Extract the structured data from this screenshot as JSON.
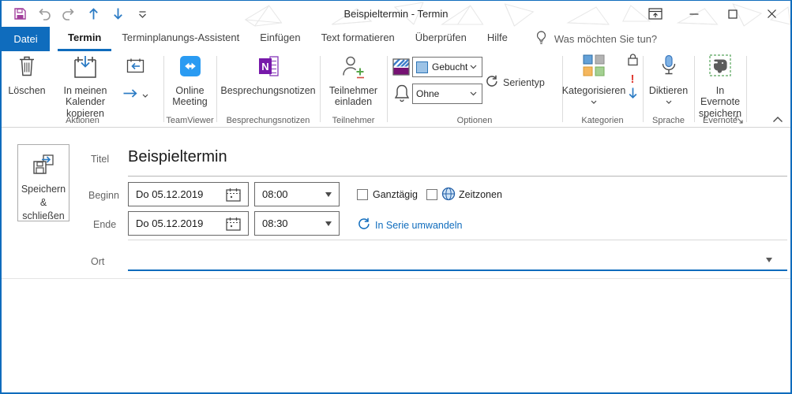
{
  "colors": {
    "accent": "#0F6CBD",
    "teamviewer_blue": "#2A9BF2",
    "onenote_purple": "#7719AA",
    "status_purple": "#761173",
    "save_icon_purple": "#A23F9C",
    "high_importance_red": "#E03B32",
    "evernote_green": "#58A55C"
  },
  "window": {
    "title": "Beispieltermin  -  Termin"
  },
  "tabs": {
    "file": "Datei",
    "items": [
      {
        "label": "Termin",
        "active": true
      },
      {
        "label": "Terminplanungs-Assistent"
      },
      {
        "label": "Einfügen"
      },
      {
        "label": "Text formatieren"
      },
      {
        "label": "Überprüfen"
      },
      {
        "label": "Hilfe"
      }
    ],
    "tellme": "Was möchten Sie tun?"
  },
  "ribbon": {
    "aktionen": {
      "label": "Aktionen",
      "delete": "Löschen",
      "copy_line1": "In meinen",
      "copy_line2": "Kalender kopieren"
    },
    "teamviewer": {
      "label": "TeamViewer",
      "online_line1": "Online",
      "online_line2": "Meeting"
    },
    "besprechungsnotizen": {
      "label": "Besprechungsnotizen",
      "button": "Besprechungsnotizen"
    },
    "teilnehmer": {
      "label": "Teilnehmer",
      "invite_line1": "Teilnehmer",
      "invite_line2": "einladen"
    },
    "optionen": {
      "label": "Optionen",
      "show_as_value": "Gebucht",
      "reminder_value": "Ohne",
      "recurrence": "Serientyp"
    },
    "kategorien": {
      "label": "Kategorien",
      "categorize": "Kategorisieren",
      "high_importance": "!"
    },
    "sprache": {
      "label": "Sprache",
      "dictate": "Diktieren"
    },
    "evernote": {
      "label": "Evernote",
      "save_line1": "In Evernote",
      "save_line2": "speichern"
    }
  },
  "form": {
    "save_close_line1": "Speichern",
    "save_close_line2": "&",
    "save_close_line3": "schließen",
    "labels": {
      "title": "Titel",
      "start": "Beginn",
      "end": "Ende",
      "location": "Ort"
    },
    "title_value": "Beispieltermin",
    "start_date": "Do 05.12.2019",
    "start_time": "08:00",
    "end_date": "Do 05.12.2019",
    "end_time": "08:30",
    "all_day_label": "Ganztägig",
    "timezones_label": "Zeitzonen",
    "recurrence_link": "In Serie umwandeln"
  }
}
